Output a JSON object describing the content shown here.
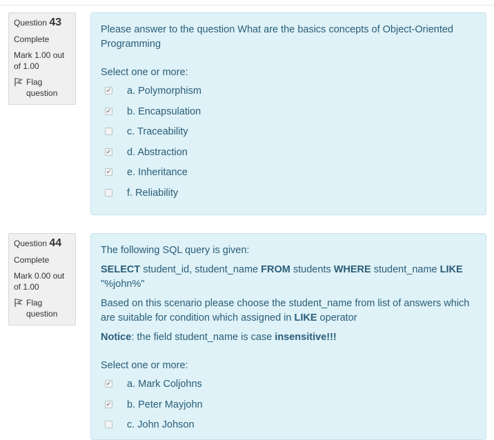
{
  "questions": [
    {
      "label": "Question",
      "number": "43",
      "state": "Complete",
      "grade": "Mark 1.00 out of 1.00",
      "flag": "Flag question",
      "text": "Please answer to the question What are the basics concepts of Object-Oriented Programming",
      "prompt": "Select one or more:",
      "options": [
        {
          "label": "a. Polymorphism",
          "checked": true
        },
        {
          "label": "b. Encapsulation",
          "checked": true
        },
        {
          "label": "c. Traceability",
          "checked": false
        },
        {
          "label": "d. Abstraction",
          "checked": true
        },
        {
          "label": "e. Inheritance",
          "checked": true
        },
        {
          "label": "f. Reliability",
          "checked": false
        }
      ]
    },
    {
      "label": "Question",
      "number": "44",
      "state": "Complete",
      "grade": "Mark 0.00 out of 1.00",
      "flag": "Flag question",
      "intro": "The following SQL query is given:",
      "sql": {
        "kw_select": "SELECT",
        "cols": " student_id, student_name ",
        "kw_from": "FROM",
        "table": " students ",
        "kw_where": "WHERE",
        "col": " student_name ",
        "kw_like": "LIKE",
        "pattern": " \"%john%\""
      },
      "scenario": {
        "before": "Based on this scenario please choose the student_name from list of answers which are suitable for condition which assigned in ",
        "kw": "LIKE",
        "after": " operator"
      },
      "notice": {
        "label": "Notice",
        "middle": ": the field student_name is case ",
        "emph": "insensitive!!!"
      },
      "prompt": "Select one or more:",
      "options": [
        {
          "label": "a. Mark Coljohns",
          "checked": true
        },
        {
          "label": "b. Peter Mayjohn",
          "checked": true
        },
        {
          "label": "c. John Johson",
          "checked": false
        }
      ]
    }
  ],
  "colors": {
    "content_bg": "#def2f8",
    "content_text": "#2b5d78",
    "info_bg": "#f0f0f0"
  }
}
